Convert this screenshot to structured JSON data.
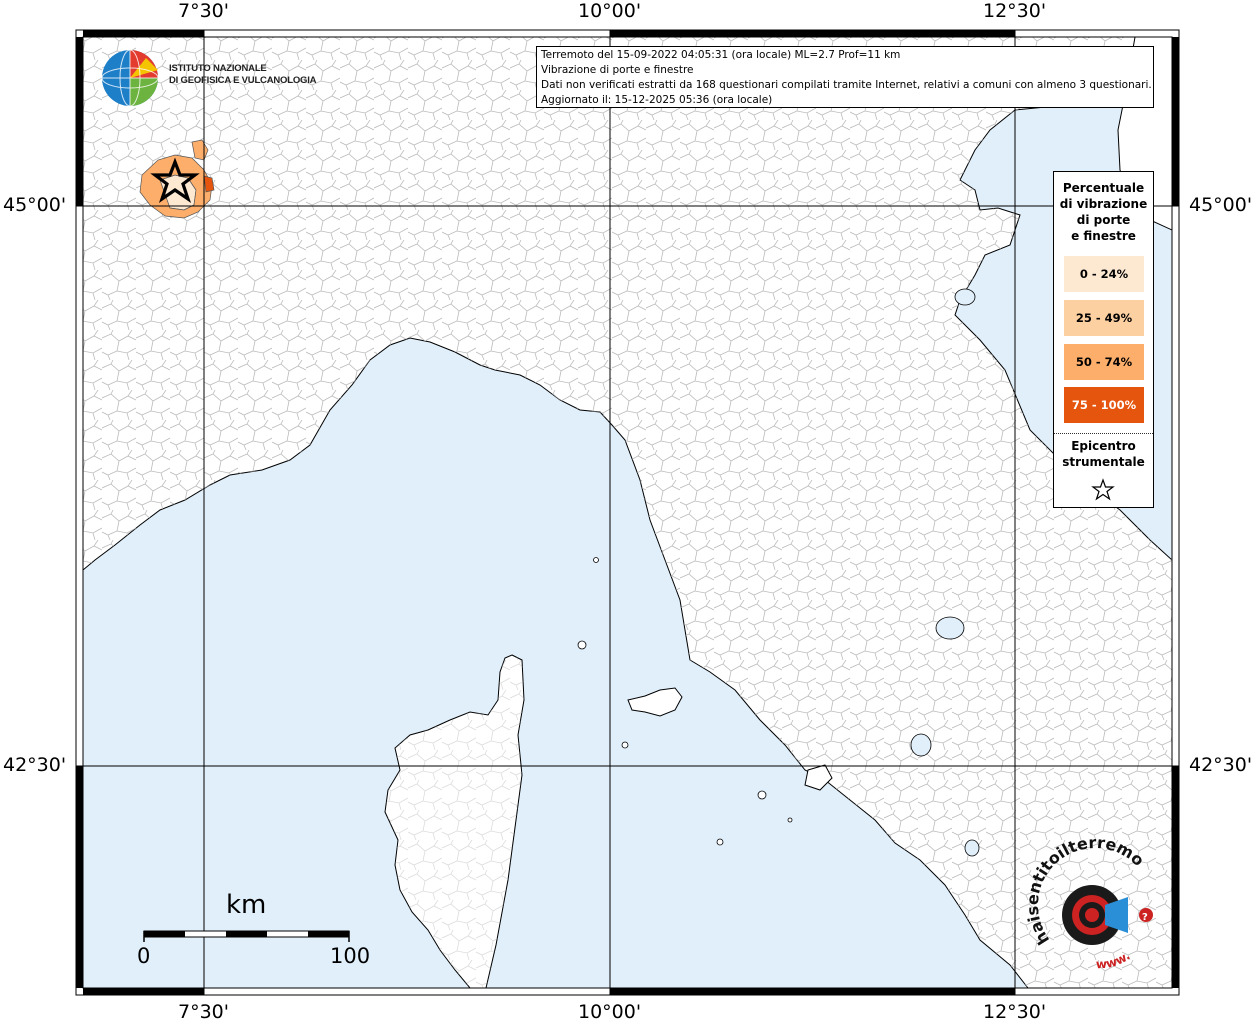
{
  "info": {
    "line1": "Terremoto del 15-09-2022 04:05:31 (ora locale) ML=2.7 Prof=11 km",
    "line2": "Vibrazione di porte e finestre",
    "line3": "Dati non verificati estratti da 168 questionari compilati tramite Internet, relativi a comuni con almeno 3 questionari.",
    "line4": "Aggiornato il: 15-12-2025 05:36 (ora locale)"
  },
  "logo": {
    "line1": "ISTITUTO NAZIONALE",
    "line2": "DI GEOFISICA E VULCANOLOGIA"
  },
  "legend": {
    "title": [
      "Percentuale",
      "di vibrazione",
      "di porte",
      "e finestre"
    ],
    "classes": [
      {
        "label": "0 - 24%",
        "color": "#fde8d2",
        "text_color": "#000000"
      },
      {
        "label": "25 - 49%",
        "color": "#fdd0a2",
        "text_color": "#000000"
      },
      {
        "label": "50 - 74%",
        "color": "#fdae6b",
        "text_color": "#000000"
      },
      {
        "label": "75 - 100%",
        "color": "#e6550d",
        "text_color": "#ffffff"
      }
    ],
    "epicenter_title": [
      "Epicentro",
      "strumentale"
    ]
  },
  "axes": {
    "longitude_ticks": [
      "7°30'",
      "10°00'",
      "12°30'"
    ],
    "latitude_ticks": [
      "45°00'",
      "42°30'"
    ]
  },
  "scale": {
    "title": "km",
    "min": "0",
    "max": "100"
  },
  "brand": {
    "arc_text": "haisentitoilterremoto.it",
    "bottom_text": "www."
  },
  "colors": {
    "sea": "#e0effa",
    "land": "#ffffff",
    "boundaries": "#b5b5b5",
    "coast": "#000000"
  }
}
